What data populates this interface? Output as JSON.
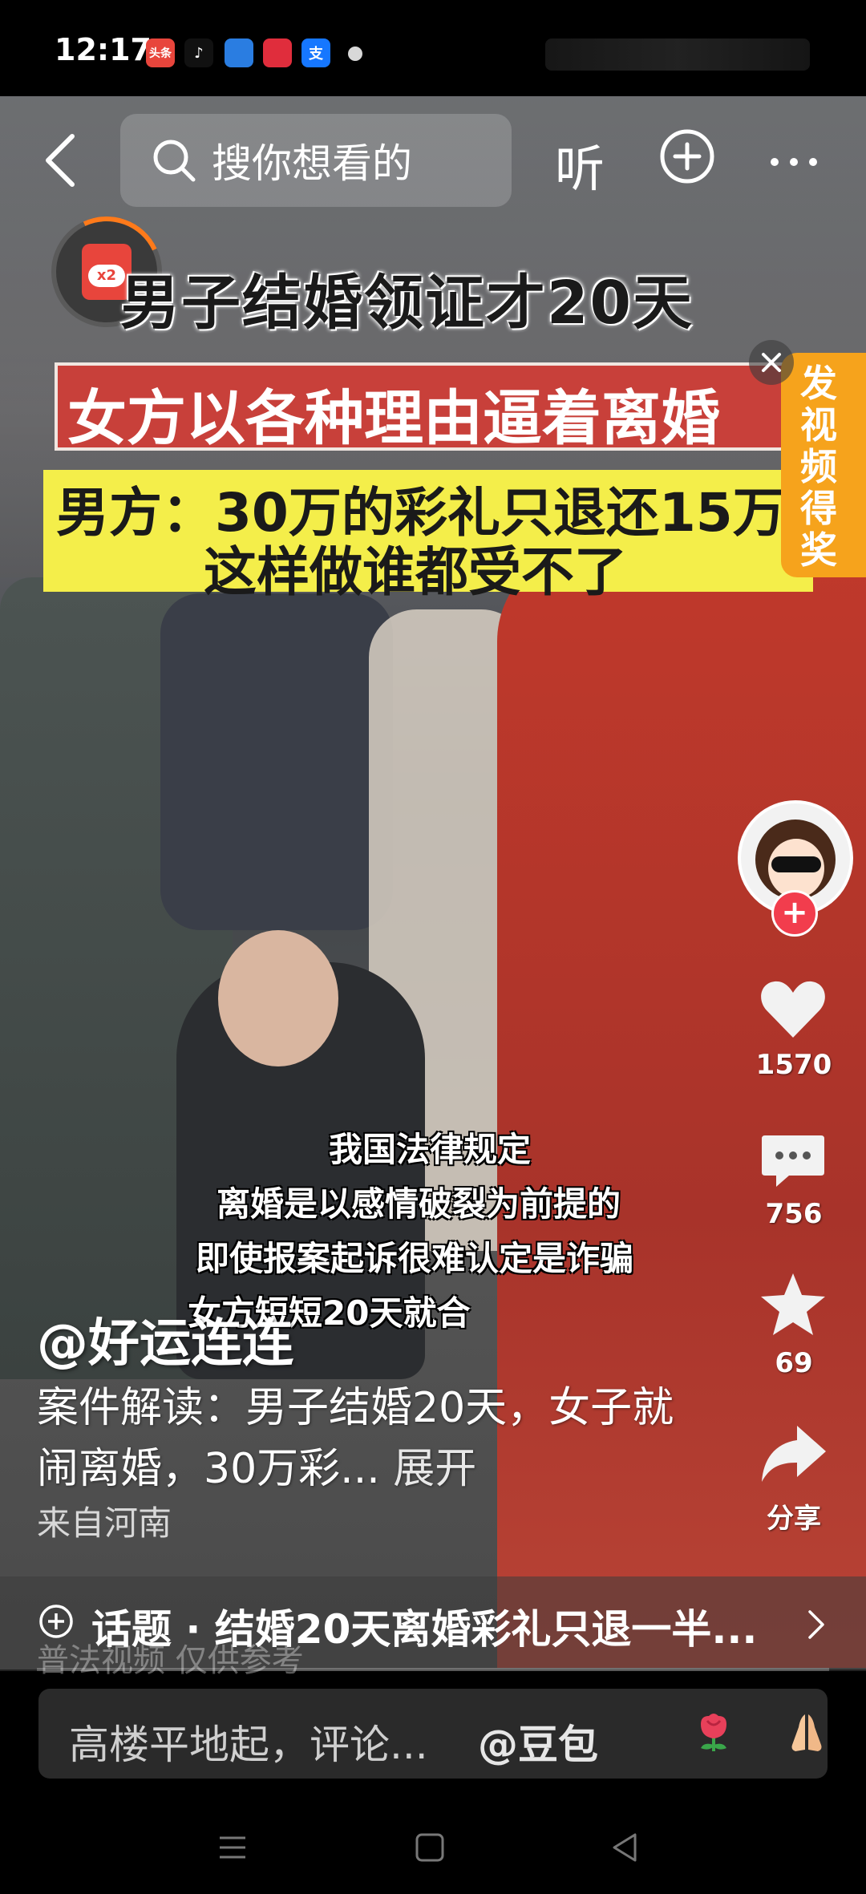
{
  "status_bar": {
    "time": "12:17",
    "apps": [
      {
        "icon": "toutiao-icon",
        "label": "头条",
        "color": "#e8453c"
      },
      {
        "icon": "tiktok-icon",
        "label": "♪",
        "color": "#111111"
      },
      {
        "icon": "browser-icon",
        "label": "",
        "color": "#2a7de1"
      },
      {
        "icon": "heart-app-icon",
        "label": "",
        "color": "#e02d3c"
      },
      {
        "icon": "alipay-icon",
        "label": "支",
        "color": "#1677ff"
      }
    ]
  },
  "top_nav": {
    "search_placeholder": "搜你想看的",
    "listen_label": "听"
  },
  "video_captions": {
    "line1": "男子结婚领证才20天",
    "line2": "女方以各种理由逼着离婚",
    "line3a": "男方：30万的彩礼只退还15万",
    "line3b": "这样做谁都受不了"
  },
  "promo_tag": {
    "label": "发视频得奖"
  },
  "subtitles": [
    "我国法律规定",
    "离婚是以感情破裂为前提的",
    "即使报案起诉很难认定是诈骗",
    "女方短短20天就合"
  ],
  "right_rail": {
    "like_count": "1570",
    "comment_count": "756",
    "favorite_count": "69",
    "share_label": "分享"
  },
  "post": {
    "author": "@好运连连",
    "description": "案件解读：男子结婚20天，女子就闹离婚，30万彩...",
    "expand_label": "展开",
    "location": "来自河南"
  },
  "topic": {
    "text": "话题 · 结婚20天离婚彩礼只退一半..."
  },
  "watermark": "普法视频  仅供参考",
  "comment_bar": {
    "placeholder": "高楼平地起，评论...",
    "mention": "@豆包"
  },
  "colors": {
    "accent_red": "#f23d4d",
    "promo_orange": "#f6a31c",
    "caption_yellow": "#f4ee4a"
  }
}
